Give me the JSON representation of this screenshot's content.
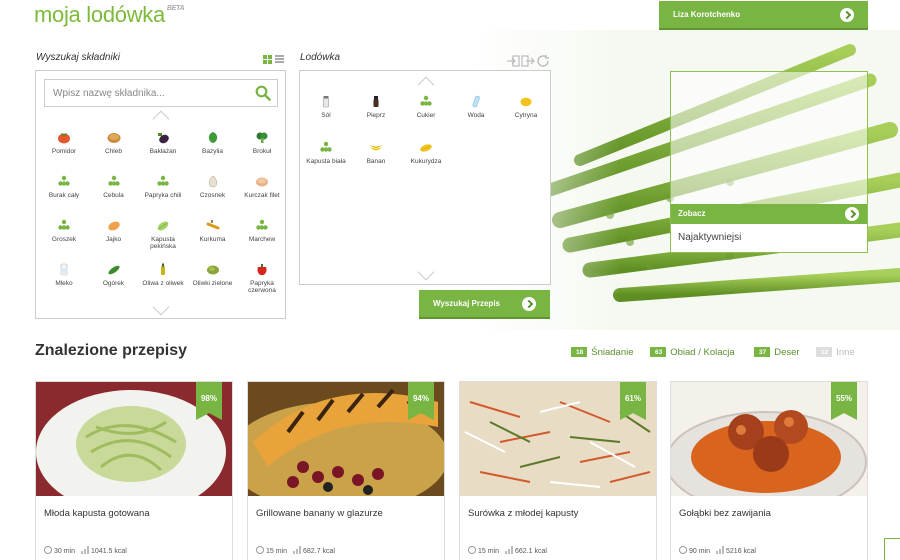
{
  "header": {
    "logo_text": "moja lodówka",
    "logo_badge": "BETA",
    "user_name": "Liza Korotchenko"
  },
  "ingredients_panel": {
    "title": "Wyszukaj składniki",
    "search_placeholder": "Wpisz nazwę składnika...",
    "items": [
      {
        "label": "Pomidor",
        "icon": "tomato-icon"
      },
      {
        "label": "Chleb",
        "icon": "bread-icon"
      },
      {
        "label": "Bakłażan",
        "icon": "eggplant-icon"
      },
      {
        "label": "Bazylia",
        "icon": "basil-icon"
      },
      {
        "label": "Brokuł",
        "icon": "broccoli-icon"
      },
      {
        "label": "Burak cały",
        "icon": "generic-dots-icon"
      },
      {
        "label": "Cebula",
        "icon": "generic-dots-icon"
      },
      {
        "label": "Papryka chili",
        "icon": "generic-dots-icon"
      },
      {
        "label": "Czosnek",
        "icon": "garlic-icon"
      },
      {
        "label": "Kurczak filet",
        "icon": "chicken-icon"
      },
      {
        "label": "Groszek",
        "icon": "generic-dots-icon"
      },
      {
        "label": "Jajko",
        "icon": "egg-icon"
      },
      {
        "label": "Kapusta pekińska",
        "icon": "cabbage-icon"
      },
      {
        "label": "Kurkuma",
        "icon": "turmeric-icon"
      },
      {
        "label": "Marchew",
        "icon": "generic-dots-icon"
      },
      {
        "label": "Mleko",
        "icon": "milk-icon"
      },
      {
        "label": "Ogórek",
        "icon": "cucumber-icon"
      },
      {
        "label": "Oliwa z oliwek",
        "icon": "olive-oil-icon"
      },
      {
        "label": "Oliwki zielone",
        "icon": "olives-icon"
      },
      {
        "label": "Papryka czerwona",
        "icon": "red-pepper-icon"
      }
    ]
  },
  "fridge_panel": {
    "title": "Lodówka",
    "items": [
      {
        "label": "Sól",
        "icon": "salt-icon"
      },
      {
        "label": "Pieprz",
        "icon": "pepper-icon"
      },
      {
        "label": "Cukier",
        "icon": "generic-dots-icon"
      },
      {
        "label": "Woda",
        "icon": "water-icon"
      },
      {
        "label": "Cytryna",
        "icon": "lemon-icon"
      },
      {
        "label": "Kapusta biała",
        "icon": "generic-dots-icon"
      },
      {
        "label": "Banan",
        "icon": "banana-icon"
      },
      {
        "label": "Kukurydza",
        "icon": "corn-icon"
      }
    ],
    "search_button": "Wyszukaj Przepis"
  },
  "featured": {
    "see_label": "Zobacz",
    "subtitle": "Najaktywniejsi"
  },
  "results": {
    "title": "Znalezione przepisy",
    "filters": [
      {
        "count": "18",
        "label": "Śniadanie",
        "active": true
      },
      {
        "count": "63",
        "label": "Obiad / Kolacja",
        "active": true
      },
      {
        "count": "37",
        "label": "Deser",
        "active": true
      },
      {
        "count": "12",
        "label": "Inne",
        "active": false
      }
    ],
    "recipes": [
      {
        "title": "Młoda kapusta gotowana",
        "match": "98%",
        "time": "30 min",
        "kcal": "1041.5 kcal"
      },
      {
        "title": "Grillowane banany w glazurze",
        "match": "94%",
        "time": "15 min",
        "kcal": "682.7 kcal"
      },
      {
        "title": "Surówka z młodej kapusty",
        "match": "61%",
        "time": "15 min",
        "kcal": "662.1 kcal"
      },
      {
        "title": "Gołąbki bez zawijania",
        "match": "55%",
        "time": "90 min",
        "kcal": "5216 kcal"
      }
    ]
  },
  "colors": {
    "accent": "#79b543",
    "accent_dark": "#5f9632"
  }
}
